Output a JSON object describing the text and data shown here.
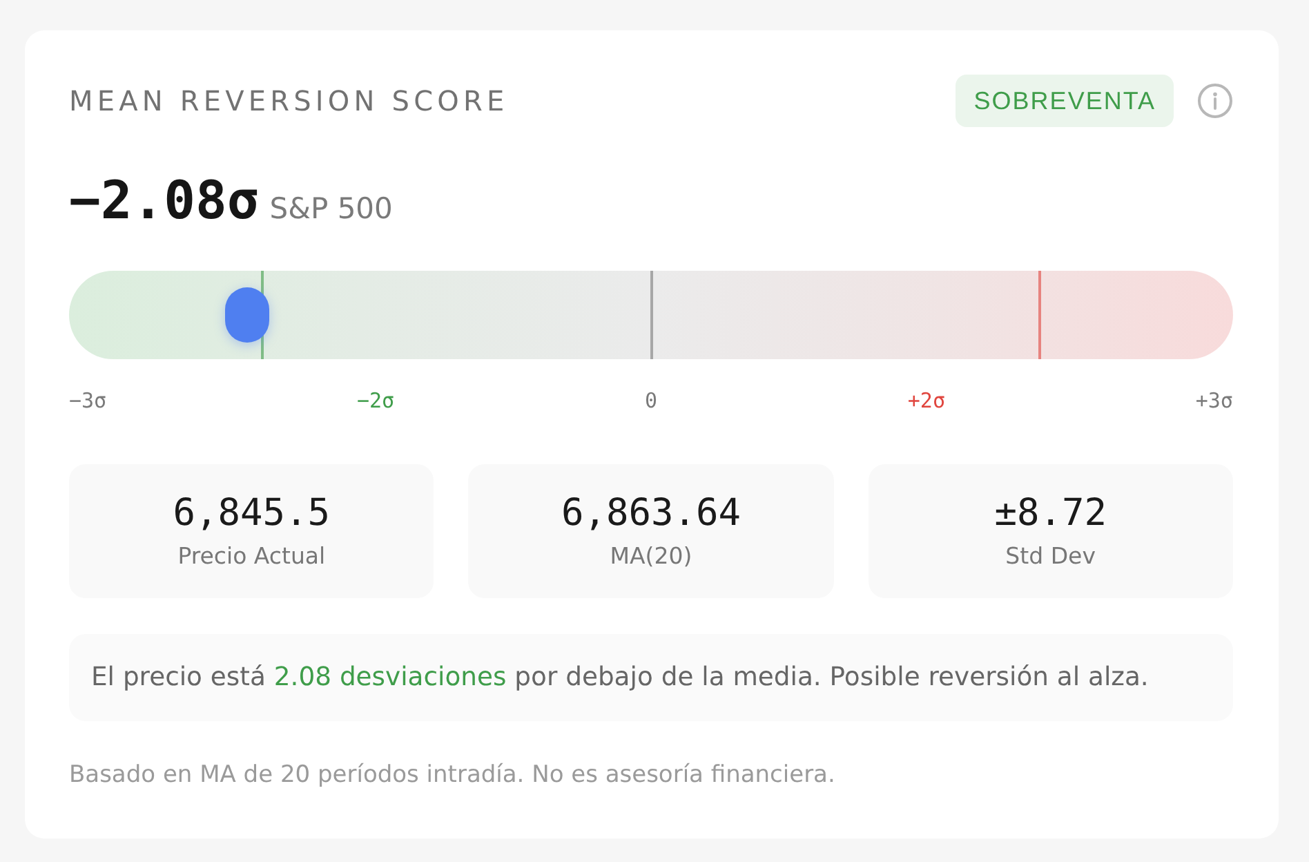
{
  "card": {
    "title": "MEAN REVERSION SCORE",
    "badge": {
      "label": "SOBREVENTA",
      "kind": "oversold"
    }
  },
  "score": {
    "value": "−2.08σ",
    "index": "S&P 500"
  },
  "gauge": {
    "level": 0.153,
    "ticks": [
      {
        "label": "−3σ",
        "color": "#7a7a7a"
      },
      {
        "label": "−2σ",
        "color": "#3f9d4a"
      },
      {
        "label": "0",
        "color": "#7a7a7a"
      },
      {
        "label": "+2σ",
        "color": "#e0453e"
      },
      {
        "label": "+3σ",
        "color": "#7a7a7a"
      }
    ]
  },
  "stats": [
    {
      "value": "6,845.5",
      "label": "Precio Actual"
    },
    {
      "value": "6,863.64",
      "label": "MA(20)"
    },
    {
      "value": "±8.72",
      "label": "Std Dev"
    }
  ],
  "message": {
    "before": "El precio está",
    "highlight": "2.08 desviaciones",
    "after": "por debajo de la media. Posible reversión al alza."
  },
  "footer": "Basado en MA de 20 períodos intradía. No es asesoría financiera."
}
